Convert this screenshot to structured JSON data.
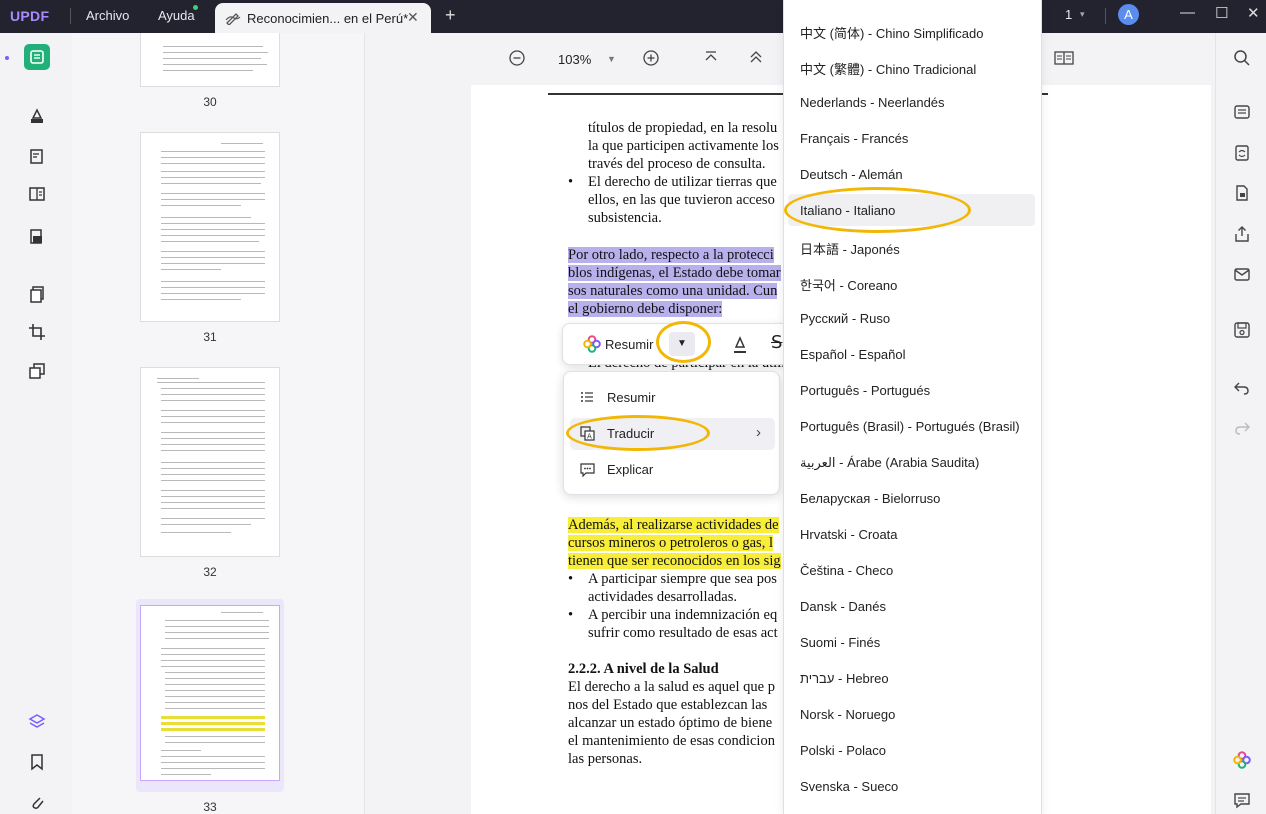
{
  "app": {
    "logo": "UPDF"
  },
  "menubar": {
    "archivo": "Archivo",
    "ayuda": "Ayuda"
  },
  "tab": {
    "title": "Reconocimien... en el Perú*",
    "close": "✕"
  },
  "titlebar": {
    "page_count": "1",
    "avatar_letter": "A"
  },
  "toolbar": {
    "zoom": "103%"
  },
  "thumbnails": [
    {
      "page": "30"
    },
    {
      "page": "31"
    },
    {
      "page": "32"
    },
    {
      "page": "33"
    }
  ],
  "document": {
    "lines": [
      "títulos de propiedad, en la resolu",
      "la que participen activamente los",
      "través del proceso de consulta.",
      "El derecho de utilizar tierras que",
      "ellos, en las que tuvieron acceso",
      "subsistencia.",
      "Por otro lado, respecto a la protecci",
      "blos indígenas, el Estado debe tomar",
      "sos naturales como una unidad. Cun",
      "el gobierno debe disponer:",
      "El derecho de participar en la utili",
      "Además, al realizarse actividades de",
      "cursos mineros o petroleros o gas, l",
      "tienen que ser reconocidos en los sig",
      "A participar siempre que sea pos",
      "actividades desarrolladas.",
      "A percibir una indemnización eq",
      "sufrir como resultado de esas act",
      "2.2.2. A nivel de la Salud",
      "El derecho a la salud es aquel que p",
      "nos del Estado que establezcan las",
      "alcanzar un estado óptimo de biene",
      "el mantenimiento de esas condicion",
      "las personas."
    ]
  },
  "floatbar": {
    "summarize": "Resumir"
  },
  "context_menu": {
    "items": [
      {
        "label": "Resumir",
        "icon": "list-icon"
      },
      {
        "label": "Traducir",
        "icon": "translate-icon"
      },
      {
        "label": "Explicar",
        "icon": "explain-icon"
      }
    ]
  },
  "languages": [
    "中文 (简体) - Chino Simplificado",
    "中文 (繁體) - Chino Tradicional",
    "Nederlands - Neerlandés",
    "Français - Francés",
    "Deutsch - Alemán",
    "Italiano - Italiano",
    "日本語 - Japonés",
    "한국어 - Coreano",
    "Русский - Ruso",
    "Español - Español",
    "Português - Portugués",
    "Português (Brasil) - Portugués (Brasil)",
    "العربية - Árabe (Arabia Saudita)",
    "Беларуская - Bielorruso",
    "Hrvatski - Croata",
    "Čeština - Checo",
    "Dansk - Danés",
    "Suomi - Finés",
    "עברית - Hebreo",
    "Norsk - Noruego",
    "Polski - Polaco",
    "Svenska - Sueco"
  ],
  "colors": {
    "accent": "#21b07a",
    "highlight_ring": "#f2b705",
    "selection_blue": "#b7b0ec",
    "highlight_yellow": "#f8ee3a",
    "titlebar": "#232330"
  }
}
